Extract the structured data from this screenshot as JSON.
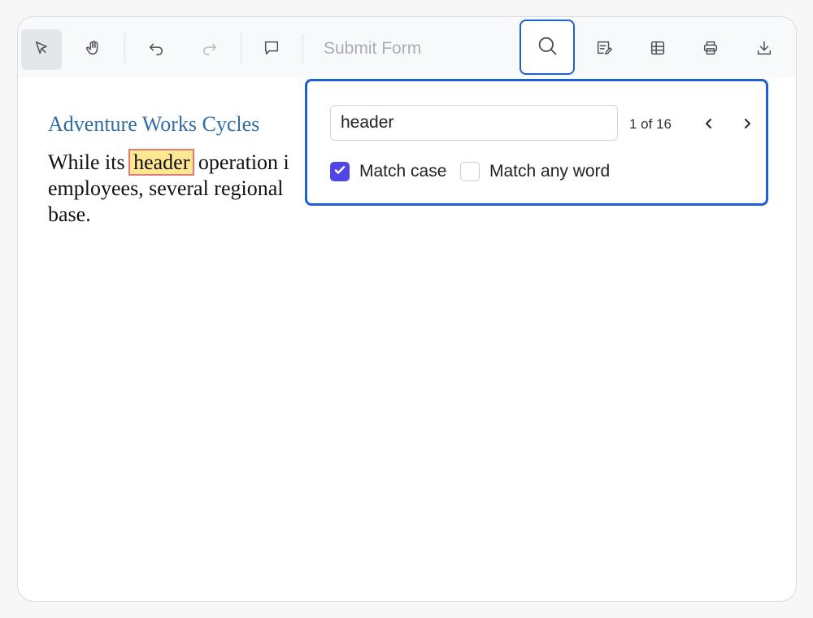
{
  "toolbar": {
    "items": [
      {
        "name": "select-tool",
        "icon": "pointer-icon"
      },
      {
        "name": "pan-tool",
        "icon": "hand-icon"
      },
      {
        "name": "undo",
        "icon": "undo-icon"
      },
      {
        "name": "redo",
        "icon": "redo-icon"
      },
      {
        "name": "comment",
        "icon": "comment-icon"
      },
      {
        "name": "search",
        "icon": "search-icon"
      },
      {
        "name": "annotate",
        "icon": "edit-annotation-icon"
      },
      {
        "name": "form-fields",
        "icon": "form-fields-icon"
      },
      {
        "name": "print",
        "icon": "printer-icon"
      },
      {
        "name": "download",
        "icon": "download-icon"
      }
    ],
    "submit_form_label": "Submit Form"
  },
  "document": {
    "title": "Adventure Works Cycles",
    "text_before": " While its ",
    "highlight": "header",
    "text_after": " operation i",
    "line2": "employees, several regional",
    "line3": "base."
  },
  "find": {
    "query": "header",
    "match_count": "1 of 16",
    "match_case_label": "Match case",
    "match_case_checked": true,
    "match_any_word_label": "Match any word",
    "match_any_word_checked": false
  },
  "colors": {
    "accent": "#1f5fd6",
    "checkbox": "#4f46e5",
    "highlight": "#fde792",
    "highlight_border": "#e07a72",
    "title": "#2f6ea5"
  }
}
